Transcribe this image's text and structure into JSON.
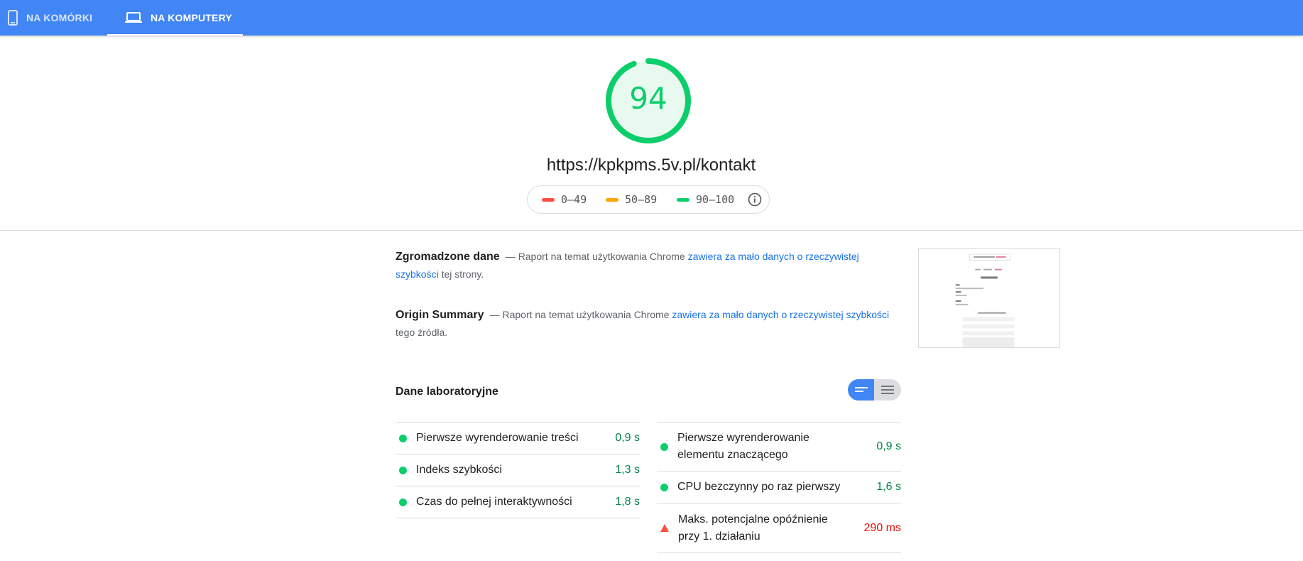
{
  "tabs": [
    {
      "label": "NA KOMÓRKI",
      "icon": "smartphone-icon"
    },
    {
      "label": "NA KOMPUTERY",
      "icon": "laptop-icon",
      "selected": true
    }
  ],
  "score": {
    "value": "94",
    "fraction": 0.94,
    "color": "#0cce6b"
  },
  "url": "https://kpkpms.5v.pl/kontakt",
  "legend": [
    {
      "label": "0–49",
      "color": "#ff4e42"
    },
    {
      "label": "50–89",
      "color": "#ffa400"
    },
    {
      "label": "90–100",
      "color": "#0cce6b"
    }
  ],
  "field_data": {
    "heading": "Zgromadzone dane",
    "text_before": "Raport na temat użytkowania Chrome",
    "link": "zawiera za mało danych o rzeczywistej szybkości",
    "text_after": "tej strony."
  },
  "origin_summary": {
    "heading": "Origin Summary",
    "text_before": "Raport na temat użytkowania Chrome",
    "link": "zawiera za mało danych o rzeczywistej szybkości",
    "text_after": "tego źródła."
  },
  "lab": {
    "title": "Dane laboratoryjne",
    "left": [
      {
        "name": "Pierwsze wyrenderowanie treści",
        "value": "0,9 s",
        "status": "good"
      },
      {
        "name": "Indeks szybkości",
        "value": "1,3 s",
        "status": "good"
      },
      {
        "name": "Czas do pełnej interaktywności",
        "value": "1,8 s",
        "status": "good"
      }
    ],
    "right": [
      {
        "name": "Pierwsze wyrenderowanie elementu znaczącego",
        "value": "0,9 s",
        "status": "good"
      },
      {
        "name": "CPU bezczynny po raz pierwszy",
        "value": "1,6 s",
        "status": "good"
      },
      {
        "name": "Maks. potencjalne opóźnienie przy 1. działaniu",
        "value": "290 ms",
        "status": "bad"
      }
    ]
  },
  "colors": {
    "accent": "#4285f4",
    "good": "#0cce6b",
    "average": "#ffa400",
    "poor": "#ff4e42",
    "link": "#1a73e8"
  }
}
